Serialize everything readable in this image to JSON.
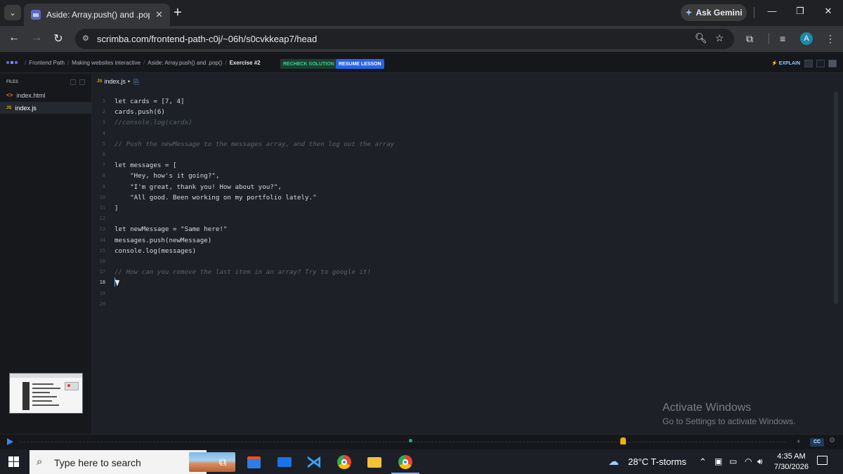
{
  "browser": {
    "tab_title": "Aside: Array.push() and .pop()",
    "tab_close": "✕",
    "new_tab": "+",
    "ask_gemini": "Ask Gemini",
    "url": "scrimba.com/frontend-path-c0j/~06h/s0cvkkeap7/head",
    "profile_initial": "A"
  },
  "header": {
    "breadcrumbs": [
      "Frontend Path",
      "Making websites interactive",
      "Aside: Array.push() and .pop()",
      "Exercise #2"
    ],
    "recheck_label": "RECHECK SOLUTION",
    "resume_label": "RESUME LESSON",
    "explain_label": "EXPLAIN"
  },
  "sidebar": {
    "files_label": "FILES",
    "files": [
      {
        "name": "index.html",
        "type": "html",
        "icon": "<>"
      },
      {
        "name": "index.js",
        "type": "js",
        "icon": "JS",
        "active": true
      }
    ]
  },
  "editor": {
    "tab_name": "index.js",
    "tab_icon": "JS",
    "tab_modified": "•",
    "current_line": 18,
    "lines": [
      {
        "n": "1",
        "text": "let cards = [7, 4]"
      },
      {
        "n": "2",
        "text": "cards.push(6)"
      },
      {
        "n": "3",
        "text": "//console.log(cards)",
        "comment": true
      },
      {
        "n": "4",
        "text": ""
      },
      {
        "n": "5",
        "text": "// Push the newMessage to the messages array, and then log out the array",
        "comment": true
      },
      {
        "n": "6",
        "text": ""
      },
      {
        "n": "7",
        "text": "let messages = ["
      },
      {
        "n": "8",
        "text": "    \"Hey, how's it going?\","
      },
      {
        "n": "9",
        "text": "    \"I'm great, thank you! How about you?\","
      },
      {
        "n": "10",
        "text": "    \"All good. Been working on my portfolio lately.\""
      },
      {
        "n": "11",
        "text": "]"
      },
      {
        "n": "12",
        "text": ""
      },
      {
        "n": "13",
        "text": "let newMessage = \"Same here!\""
      },
      {
        "n": "14",
        "text": "messages.push(newMessage)"
      },
      {
        "n": "15",
        "text": "console.log(messages)"
      },
      {
        "n": "16",
        "text": ""
      },
      {
        "n": "17",
        "text": "// How can you remove the last item in an array? Try to google it!",
        "comment": true
      },
      {
        "n": "18",
        "text": ""
      },
      {
        "n": "19",
        "text": ""
      },
      {
        "n": "20",
        "text": ""
      }
    ]
  },
  "watermark": {
    "title": "Activate Windows",
    "subtitle": "Go to Settings to activate Windows."
  },
  "player": {
    "cc_label": "CC"
  },
  "taskbar": {
    "search_placeholder": "Type here to search",
    "weather": "28°C  T-storms",
    "time": "4:35 AM",
    "date": "7/30/2026"
  }
}
